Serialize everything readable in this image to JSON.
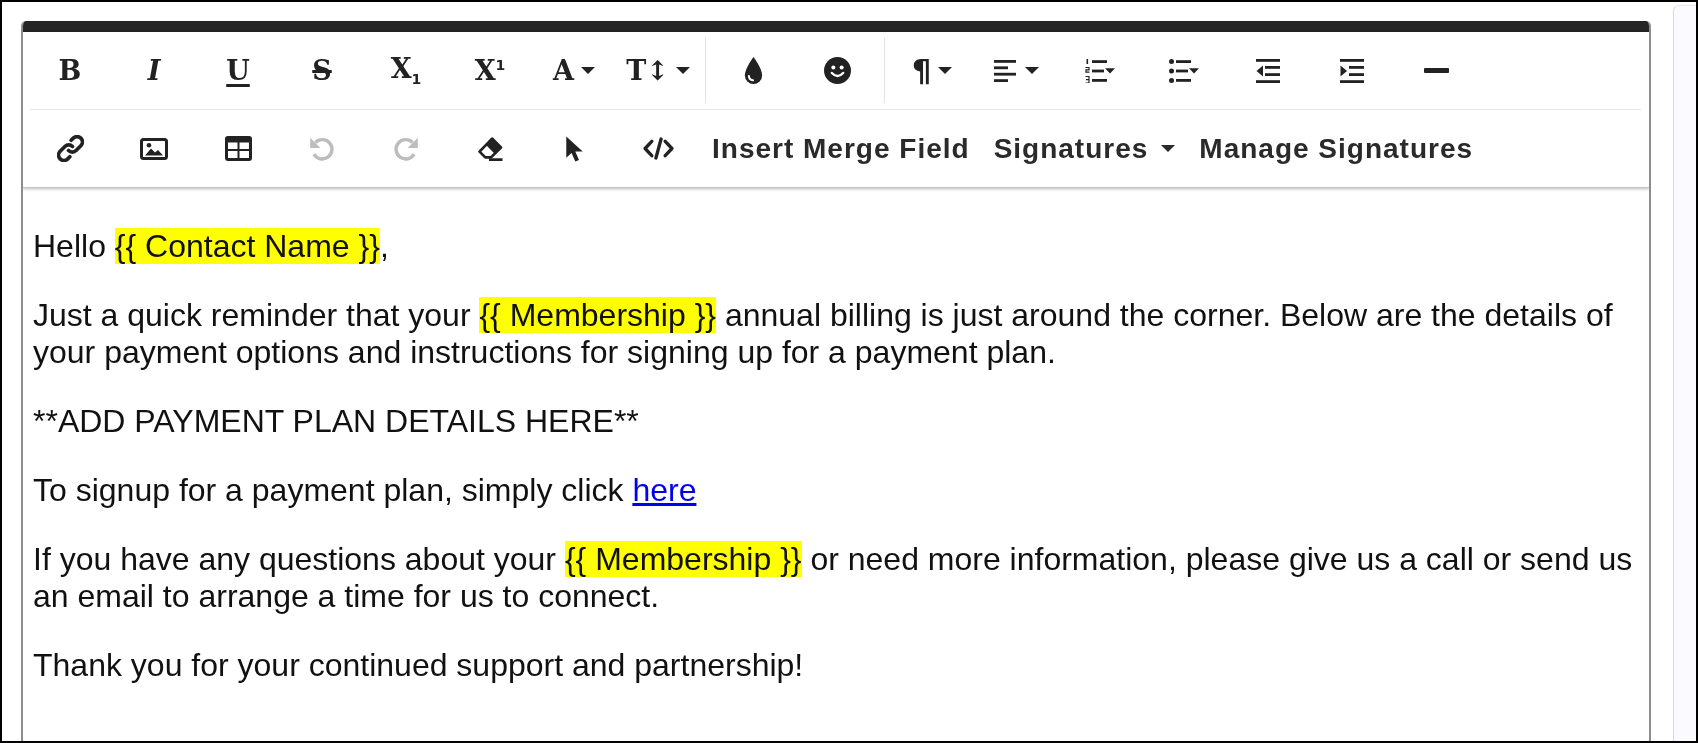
{
  "toolbar": {
    "rows": [
      {
        "groups": [
          {
            "buttons": [
              {
                "kind": "bold",
                "label": "B",
                "dropdown": false,
                "disabled": false
              },
              {
                "kind": "italic",
                "label": "I",
                "dropdown": false,
                "disabled": false
              },
              {
                "kind": "underline",
                "label": "U",
                "dropdown": false,
                "disabled": false
              },
              {
                "kind": "strikethrough",
                "label": "S",
                "dropdown": false,
                "disabled": false
              },
              {
                "kind": "subscript",
                "label": "X$_{1}$",
                "dropdown": false,
                "disabled": false
              },
              {
                "kind": "superscript",
                "label": "X$^{1}$",
                "dropdown": false,
                "disabled": false
              },
              {
                "kind": "font",
                "label": "A",
                "dropdown": true,
                "disabled": false
              },
              {
                "kind": "size",
                "label": "T↕",
                "dropdown": true,
                "disabled": false
              }
            ]
          },
          {
            "buttons": [
              {
                "kind": "color",
                "dropdown": false,
                "disabled": false
              },
              {
                "kind": "emoji",
                "dropdown": false,
                "disabled": false
              }
            ]
          },
          {
            "buttons": [
              {
                "kind": "paragraph",
                "label": "¶",
                "dropdown": true,
                "disabled": false
              },
              {
                "kind": "align",
                "dropdown": true,
                "disabled": false
              },
              {
                "kind": "numbered",
                "dropdown": false,
                "disabled": false
              },
              {
                "kind": "bulleted",
                "dropdown": false,
                "disabled": false
              },
              {
                "kind": "outdent",
                "dropdown": false,
                "disabled": false
              },
              {
                "kind": "indent",
                "dropdown": false,
                "disabled": false
              },
              {
                "kind": "rule",
                "dropdown": false,
                "disabled": false
              }
            ]
          }
        ]
      },
      {
        "groups": [
          {
            "buttons": [
              {
                "kind": "link",
                "dropdown": false,
                "disabled": false
              },
              {
                "kind": "image",
                "dropdown": false,
                "disabled": false
              },
              {
                "kind": "table",
                "dropdown": false,
                "disabled": false
              },
              {
                "kind": "undo",
                "dropdown": false,
                "disabled": true
              },
              {
                "kind": "redo",
                "dropdown": false,
                "disabled": true
              },
              {
                "kind": "eraser",
                "dropdown": false,
                "disabled": false
              },
              {
                "kind": "select",
                "dropdown": false,
                "disabled": false
              },
              {
                "kind": "code",
                "dropdown": false,
                "disabled": false
              },
              {
                "kind": "merge",
                "label": "Insert Merge Field",
                "dropdown": false,
                "disabled": false
              },
              {
                "kind": "signatures",
                "label": "Signatures",
                "dropdown": true,
                "disabled": false
              },
              {
                "kind": "manage",
                "label": "Manage Signatures",
                "dropdown": false,
                "disabled": false
              }
            ]
          }
        ]
      }
    ]
  },
  "editor": {
    "paragraphs": [
      {
        "segments": [
          {
            "kind": "text",
            "text": "Hello "
          },
          {
            "kind": "merge_field",
            "text": "{{ Contact Name }}"
          },
          {
            "kind": "text",
            "text": ","
          }
        ]
      },
      {
        "segments": [
          {
            "kind": "text",
            "text": "Just a quick reminder that your "
          },
          {
            "kind": "merge_field",
            "text": "{{ Membership }}"
          },
          {
            "kind": "text",
            "text": " annual billing is just around the corner. Below are the details of your payment options and instructions for signing up for a payment plan."
          }
        ]
      },
      {
        "segments": [
          {
            "kind": "text",
            "text": "**ADD PAYMENT PLAN DETAILS HERE**"
          }
        ]
      },
      {
        "segments": [
          {
            "kind": "text",
            "text": "To signup for a payment plan, simply click "
          },
          {
            "kind": "link",
            "text": "here"
          }
        ]
      },
      {
        "segments": [
          {
            "kind": "text",
            "text": "If you have any questions about your "
          },
          {
            "kind": "merge_field",
            "text": "{{ Membership }}"
          },
          {
            "kind": "text",
            "text": " or need more information, please give us a call or send us an email to arrange a time for us to connect."
          }
        ]
      },
      {
        "segments": [
          {
            "kind": "text",
            "text": "Thank you for your continued support and partnership!"
          }
        ]
      }
    ]
  }
}
